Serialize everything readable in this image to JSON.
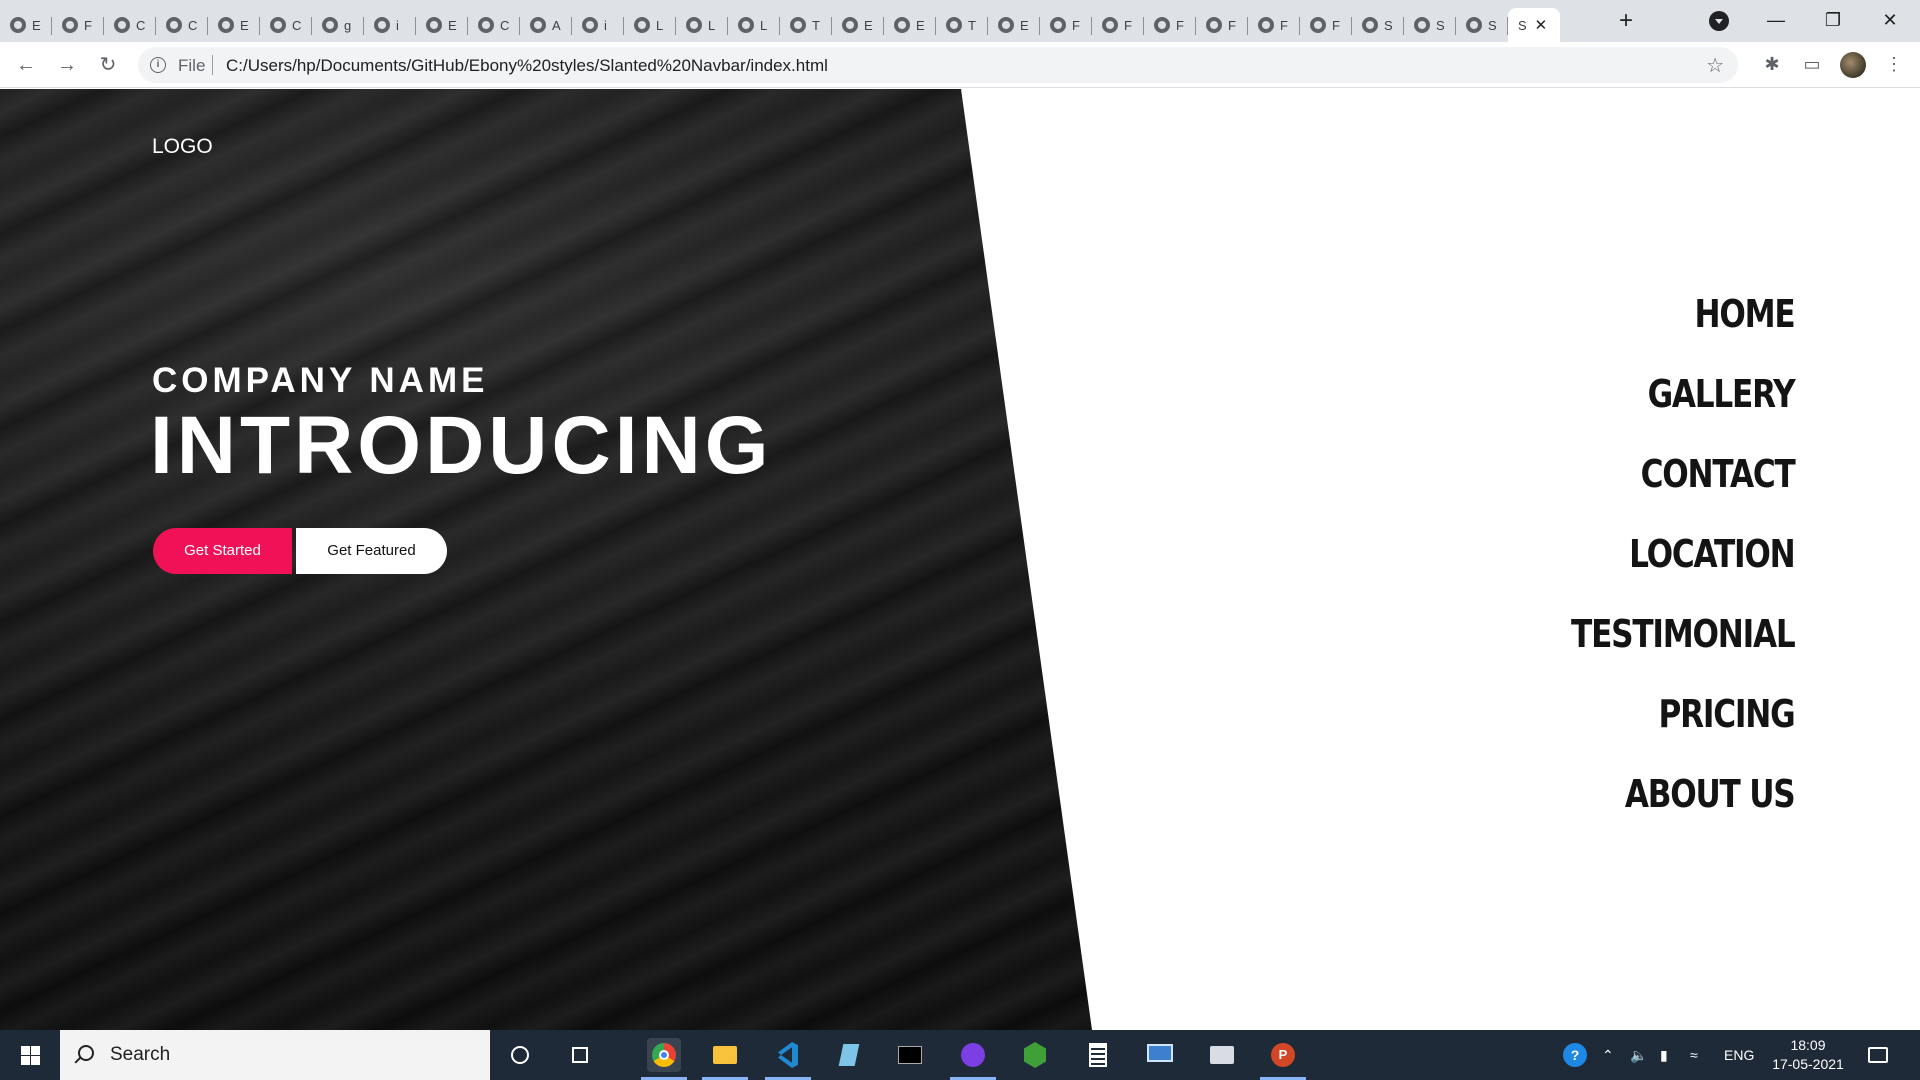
{
  "browser": {
    "tab_titles": [
      "E",
      "F",
      "C",
      "C",
      "E",
      "C",
      "g",
      "i",
      "E",
      "C",
      "A",
      "i",
      "L",
      "L",
      "L",
      "T",
      "E",
      "E",
      "T",
      "E",
      "F",
      "F",
      "F",
      "F",
      "F",
      "F",
      "S",
      "S",
      "S"
    ],
    "active_tab_title": "S",
    "address": {
      "scheme_label": "File",
      "url": "C:/Users/hp/Documents/GitHub/Ebony%20styles/Slanted%20Navbar/index.html"
    }
  },
  "page": {
    "logo": "LOGO",
    "company_name": "COMPANY NAME",
    "headline": "INTRODUCING",
    "buttons": {
      "primary": "Get Started",
      "secondary": "Get Featured"
    },
    "menu": [
      "HOME",
      "GALLERY",
      "CONTACT",
      "LOCATION",
      "TESTIMONIAL",
      "PRICING",
      "ABOUT US"
    ],
    "colors": {
      "accent": "#f01157",
      "hero_background": "#111111",
      "menu_text": "#141414"
    }
  },
  "taskbar": {
    "search_placeholder": "Search",
    "language": "ENG",
    "time": "18:09",
    "date": "17-05-2021",
    "apps": [
      "chrome-icon",
      "file-explorer-icon",
      "vscode-icon",
      "notepad-icon",
      "terminal-icon",
      "github-desktop-icon",
      "nodejs-icon",
      "calculator-icon",
      "remote-desktop-icon",
      "photos-icon",
      "powerpoint-icon"
    ]
  }
}
